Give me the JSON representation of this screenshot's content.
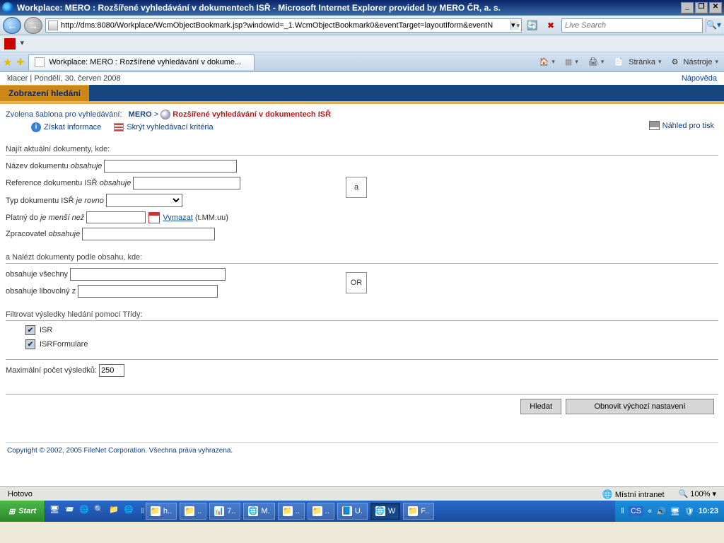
{
  "window": {
    "title": "Workplace: MERO : Rozšířené vyhledávání v dokumentech ISŘ - Microsoft Internet Explorer provided by MERO ČR, a. s."
  },
  "ie": {
    "address": "http://dms:8080/Workplace/WcmObjectBookmark.jsp?windowId=_1.WcmObjectBookmark0&eventTarget=layoutIform&eventN",
    "search_placeholder": "Live Search",
    "tab_title": "Workplace: MERO : Rozšířené vyhledávání v dokume...",
    "menu_page": "Stránka",
    "menu_tools": "Nástroje"
  },
  "page": {
    "user": "klacer",
    "date": "Pondělí, 30. červen 2008",
    "help": "Nápověda",
    "tab_label": "Zobrazení hledání",
    "breadcrumb_prefix": "Zvolena šablona pro vyhledávání:",
    "breadcrumb_root": "MERO",
    "breadcrumb_sep": ">",
    "breadcrumb_title": "Rozšířené vyhledávání v dokumentech ISŘ",
    "action_info": "Získat informace",
    "action_hide": "Skrýt vyhledávací kritéria",
    "print_preview": "Náhled pro tisk",
    "section1": "Najít aktuální dokumenty, kde:",
    "f1_label": "Název dokumentu",
    "f1_op": "obsahuje",
    "f2_label": "Reference dokumentu ISŘ",
    "f2_op": "obsahuje",
    "f3_label": "Typ dokumentu ISŘ",
    "f3_op": "je rovno",
    "f4_label": "Platný do",
    "f4_op": "je menší než",
    "f4_clear": "Vymazat",
    "f4_format": "(t.MM.uu)",
    "f5_label": "Zpracovatel",
    "f5_op": "obsahuje",
    "op_a": "a",
    "section2": "a Nalézt dokumenty podle obsahu, kde:",
    "g1": "obsahuje všechny",
    "g2": "obsahuje libovolný z",
    "op_or": "OR",
    "section3": "Filtrovat výsledky hledání pomocí Třídy:",
    "class1": "ISR",
    "class2": "ISRFormulare",
    "max_label": "Maximální počet výsledků:",
    "max_value": "250",
    "btn_search": "Hledat",
    "btn_reset": "Obnovit výchozí nastavení",
    "footer": "Copyright © 2002, 2005 FileNet Corporation. Všechna práva vyhrazena."
  },
  "status": {
    "done": "Hotovo",
    "zone": "Místní intranet",
    "zoom": "100%"
  },
  "taskbar": {
    "start": "Start",
    "apps": [
      "h..",
      "..",
      "7..",
      "M.",
      "..",
      "..",
      "U.",
      "W",
      "F.."
    ],
    "lang": "CS",
    "arrows": "«",
    "clock": "10:23"
  }
}
